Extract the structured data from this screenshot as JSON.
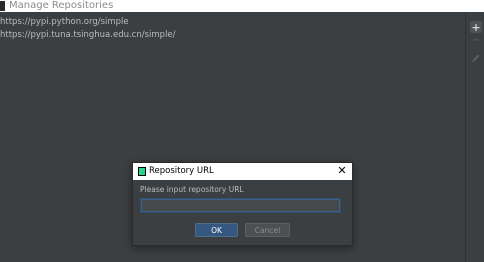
{
  "window": {
    "title": "Manage Repositories"
  },
  "repositories": [
    "https://pypi.python.org/simple",
    "https://pypi.tuna.tsinghua.edu.cn/simple/"
  ],
  "toolbar": {
    "add": "+",
    "remove": "−"
  },
  "dialog": {
    "title": "Repository URL",
    "close": "✕",
    "prompt": "Please input repository URL",
    "input_value": "",
    "ok_label": "OK",
    "cancel_label": "Cancel"
  },
  "colors": {
    "background": "#3c3f41",
    "accent_button": "#365880",
    "focus_border": "#3d6185",
    "text": "#bbbbbb"
  }
}
